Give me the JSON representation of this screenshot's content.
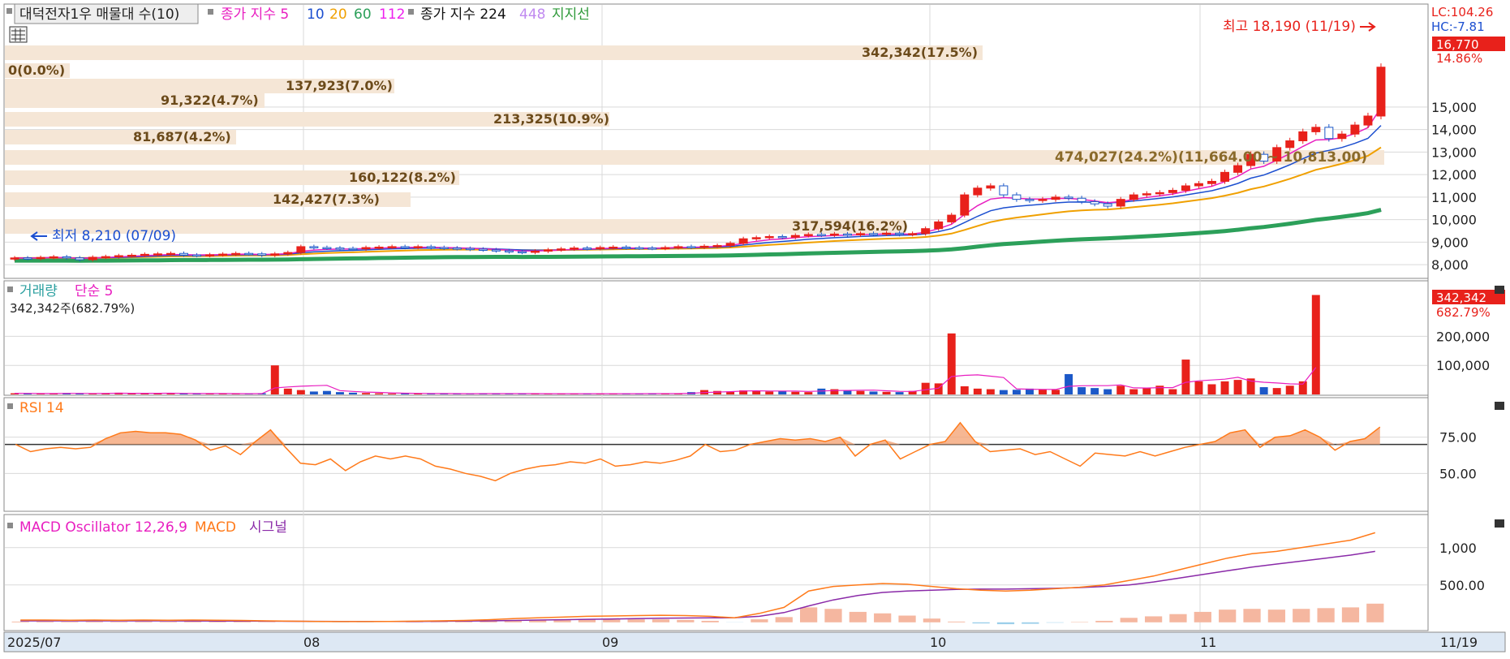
{
  "colors": {
    "up": "#e8211b",
    "down": "#1c58c8",
    "ma5": "#e81ec0",
    "ma10": "#1c4fd0",
    "ma20": "#f0a000",
    "ma60": "#2ca05a",
    "ma112": "#ee22ee",
    "ma224": "#111111",
    "ma448": "#c08af0",
    "support": "#2f9a3a",
    "profile": "#f5e6d6",
    "grid": "#d9d9d9",
    "panel_border": "#8a8a8a",
    "axis_bg": "#dde8f4",
    "rsi": "#ff7a1a",
    "macd": "#ff7a1a",
    "signal": "#8a2aa8",
    "osc": "#f5b7a0"
  },
  "price_panel": {
    "legend": {
      "title": "대덕전자1우 매물대 수(10)",
      "ma_label": "종가 지수 5",
      "ma10": "10",
      "ma20": "20",
      "ma60": "60",
      "ma112": "112",
      "ma224_label": "종가 지수 224",
      "ma448": "448",
      "support_label": "지지선"
    },
    "high_note": "최고 18,190 (11/19)",
    "low_note": "최저 8,210 (07/09)",
    "zone_note": "474,027(24.2%)(11,664.00 ~ 10,813.00)",
    "right_labels": {
      "lc": "LC:104.26",
      "hc": "HC:-7.81",
      "price": "16,770",
      "pct": "14.86%"
    },
    "volume_profile_labels": [
      "342,342(17.5%)",
      "0(0.0%)",
      "137,923(7.0%)",
      "91,322(4.7%)",
      "213,325(10.9%)",
      "81,687(4.2%)",
      "160,122(8.2%)",
      "142,427(7.3%)",
      "317,594(16.2%)"
    ],
    "y_ticks": [
      "15,000",
      "14,000",
      "13,000",
      "12,000",
      "11,000",
      "10,000",
      "9,000",
      "8,000"
    ]
  },
  "volume_panel": {
    "title": "거래량",
    "ma_label": "단순 5",
    "info": "342,342주(682.79%)",
    "right_value": "342,342",
    "right_pct": "682.79%",
    "y_ticks": [
      "200,000",
      "100,000"
    ]
  },
  "rsi_panel": {
    "title": "RSI 14",
    "y_ticks": [
      "75.00",
      "50.00"
    ]
  },
  "macd_panel": {
    "title": "MACD Oscillator 12,26,9",
    "macd_label": "MACD",
    "signal_label": "시그널",
    "y_ticks": [
      "1,000",
      "500.00"
    ]
  },
  "x_axis": {
    "labels": [
      "2025/07",
      "08",
      "09",
      "10",
      "11"
    ],
    "end_label": "11/19"
  },
  "chart_data": [
    {
      "type": "candlestick",
      "title": "대덕전자1우",
      "x": [
        "07/01",
        "07/02",
        "07/03",
        "07/04",
        "07/07",
        "07/08",
        "07/09",
        "07/10",
        "07/11",
        "07/14",
        "07/15",
        "07/16",
        "07/17",
        "07/18",
        "07/21",
        "07/22",
        "07/23",
        "07/24",
        "07/25",
        "07/28",
        "07/29",
        "07/30",
        "07/31",
        "08/01",
        "08/04",
        "08/05",
        "08/06",
        "08/07",
        "08/08",
        "08/11",
        "08/12",
        "08/13",
        "08/14",
        "08/18",
        "08/19",
        "08/20",
        "08/21",
        "08/22",
        "08/25",
        "08/26",
        "08/27",
        "08/28",
        "08/29",
        "09/01",
        "09/02",
        "09/03",
        "09/04",
        "09/05",
        "09/08",
        "09/09",
        "09/10",
        "09/11",
        "09/12",
        "09/15",
        "09/16",
        "09/17",
        "09/18",
        "09/19",
        "09/22",
        "09/23",
        "09/24",
        "09/25",
        "09/26",
        "09/29",
        "09/30",
        "10/01",
        "10/02",
        "10/10",
        "10/13",
        "10/14",
        "10/15",
        "10/16",
        "10/17",
        "10/20",
        "10/21",
        "10/22",
        "10/23",
        "10/24",
        "10/27",
        "10/28",
        "10/29",
        "10/30",
        "10/31",
        "11/03",
        "11/04",
        "11/05",
        "11/06",
        "11/07",
        "11/10",
        "11/11",
        "11/12",
        "11/13",
        "11/14",
        "11/17",
        "11/18",
        "11/19"
      ],
      "open": [
        8250,
        8300,
        8280,
        8320,
        8350,
        8300,
        8220,
        8330,
        8360,
        8400,
        8420,
        8460,
        8480,
        8500,
        8430,
        8410,
        8440,
        8470,
        8500,
        8480,
        8420,
        8480,
        8540,
        8800,
        8760,
        8740,
        8720,
        8700,
        8760,
        8780,
        8800,
        8770,
        8800,
        8760,
        8740,
        8720,
        8690,
        8660,
        8620,
        8580,
        8550,
        8600,
        8660,
        8700,
        8740,
        8720,
        8760,
        8780,
        8750,
        8740,
        8730,
        8760,
        8800,
        8780,
        8820,
        8850,
        8950,
        9150,
        9200,
        9250,
        9220,
        9300,
        9340,
        9320,
        9360,
        9330,
        9380,
        9360,
        9400,
        9350,
        9380,
        9600,
        9900,
        10200,
        11100,
        11400,
        11500,
        11100,
        10900,
        10850,
        10900,
        11000,
        10950,
        10800,
        10700,
        10600,
        10900,
        11100,
        11150,
        11200,
        11300,
        11500,
        11600,
        11700,
        12100,
        12400,
        12900,
        12600,
        13200,
        13500,
        13900,
        14100,
        13600,
        13800,
        14200,
        14600
      ],
      "close": [
        8300,
        8280,
        8320,
        8350,
        8300,
        8220,
        8330,
        8360,
        8400,
        8420,
        8460,
        8480,
        8500,
        8430,
        8410,
        8440,
        8470,
        8500,
        8480,
        8420,
        8480,
        8540,
        8800,
        8760,
        8740,
        8720,
        8700,
        8760,
        8780,
        8800,
        8770,
        8800,
        8760,
        8740,
        8720,
        8690,
        8660,
        8620,
        8580,
        8550,
        8600,
        8660,
        8700,
        8740,
        8720,
        8760,
        8780,
        8750,
        8740,
        8730,
        8760,
        8800,
        8780,
        8820,
        8850,
        8950,
        9150,
        9200,
        9250,
        9220,
        9300,
        9340,
        9320,
        9360,
        9330,
        9380,
        9360,
        9400,
        9350,
        9380,
        9600,
        9900,
        10200,
        11100,
        11400,
        11500,
        11100,
        10900,
        10850,
        10900,
        11000,
        10950,
        10800,
        10700,
        10600,
        10900,
        11100,
        11150,
        11200,
        11300,
        11500,
        11600,
        11700,
        12100,
        12400,
        12900,
        12600,
        13200,
        13500,
        13900,
        14100,
        13600,
        13800,
        14200,
        14600,
        16770
      ],
      "volume": [
        4000,
        3000,
        2500,
        3000,
        5000,
        4000,
        2500,
        3500,
        6000,
        4000,
        3500,
        3000,
        4000,
        3000,
        2500,
        3000,
        2500,
        3000,
        2000,
        4000,
        100000,
        20000,
        15000,
        10000,
        12000,
        8000,
        6000,
        5000,
        4000,
        3000,
        3500,
        3000,
        2500,
        3000,
        2500,
        2000,
        3500,
        3000,
        2500,
        3000,
        2000,
        2500,
        3000,
        2500,
        2000,
        3000,
        2500,
        3000,
        2500,
        3000,
        3500,
        2500,
        8000,
        15000,
        12000,
        10000,
        14000,
        12000,
        10000,
        12000,
        9000,
        8000,
        20000,
        18000,
        14000,
        12000,
        10000,
        9000,
        8000,
        12000,
        40000,
        38000,
        210000,
        28000,
        20000,
        18000,
        15000,
        16000,
        20000,
        18000,
        16000,
        70000,
        25000,
        22000,
        18000,
        30000,
        18000,
        22000,
        30000,
        18000,
        120000,
        45000,
        35000,
        45000,
        50000,
        55000,
        25000,
        22000,
        30000,
        45000,
        342342
      ],
      "ylim": [
        7500,
        19500
      ]
    },
    {
      "type": "line",
      "title": "RSI 14",
      "values": [
        70,
        65,
        67,
        68,
        67,
        68,
        74,
        78,
        79,
        78,
        78,
        77,
        73,
        66,
        69,
        63,
        72,
        80,
        68,
        57,
        56,
        60,
        52,
        58,
        62,
        60,
        62,
        60,
        55,
        53,
        50,
        48,
        45,
        50,
        53,
        55,
        56,
        58,
        57,
        60,
        55,
        56,
        58,
        57,
        59,
        62,
        70,
        65,
        66,
        70,
        72,
        74,
        73,
        74,
        72,
        75,
        62,
        70,
        73,
        60,
        65,
        70,
        72,
        85,
        72,
        65,
        66,
        67,
        63,
        65,
        60,
        55,
        64,
        63,
        62,
        65,
        62,
        65,
        68,
        70,
        72,
        78,
        80,
        68,
        75,
        76,
        80,
        75,
        66,
        72,
        74,
        82
      ],
      "ylim": [
        25,
        100
      ],
      "reference_line": 70
    },
    {
      "type": "line",
      "title": "MACD Oscillator 12,26,9",
      "series": [
        {
          "name": "MACD",
          "values": [
            30,
            30,
            28,
            30,
            28,
            30,
            28,
            30,
            28,
            25,
            20,
            15,
            12,
            10,
            10,
            12,
            15,
            20,
            25,
            35,
            50,
            60,
            70,
            80,
            85,
            90,
            95,
            90,
            80,
            60,
            120,
            200,
            420,
            480,
            500,
            520,
            510,
            480,
            450,
            430,
            420,
            430,
            450,
            470,
            500,
            560,
            620,
            700,
            780,
            860,
            920,
            950,
            1000,
            1050,
            1100,
            1200
          ]
        },
        {
          "name": "시그널",
          "values": [
            20,
            20,
            20,
            20,
            20,
            20,
            20,
            18,
            17,
            16,
            15,
            14,
            13,
            12,
            12,
            12,
            12,
            14,
            16,
            20,
            25,
            30,
            35,
            40,
            45,
            50,
            55,
            58,
            60,
            62,
            80,
            130,
            220,
            300,
            360,
            400,
            420,
            430,
            440,
            445,
            445,
            450,
            455,
            465,
            480,
            500,
            540,
            590,
            640,
            690,
            740,
            780,
            820,
            860,
            900,
            950
          ]
        }
      ],
      "oscillator": [
        10,
        10,
        8,
        10,
        8,
        10,
        8,
        12,
        11,
        9,
        5,
        1,
        -1,
        -2,
        -2,
        0,
        3,
        6,
        9,
        15,
        25,
        30,
        35,
        40,
        40,
        40,
        40,
        32,
        20,
        -2,
        40,
        70,
        200,
        180,
        140,
        120,
        90,
        50,
        10,
        -15,
        -25,
        -20,
        -5,
        5,
        20,
        60,
        80,
        110,
        140,
        170,
        180,
        170,
        180,
        190,
        200,
        250
      ],
      "ylim": [
        -100,
        1400
      ]
    }
  ]
}
